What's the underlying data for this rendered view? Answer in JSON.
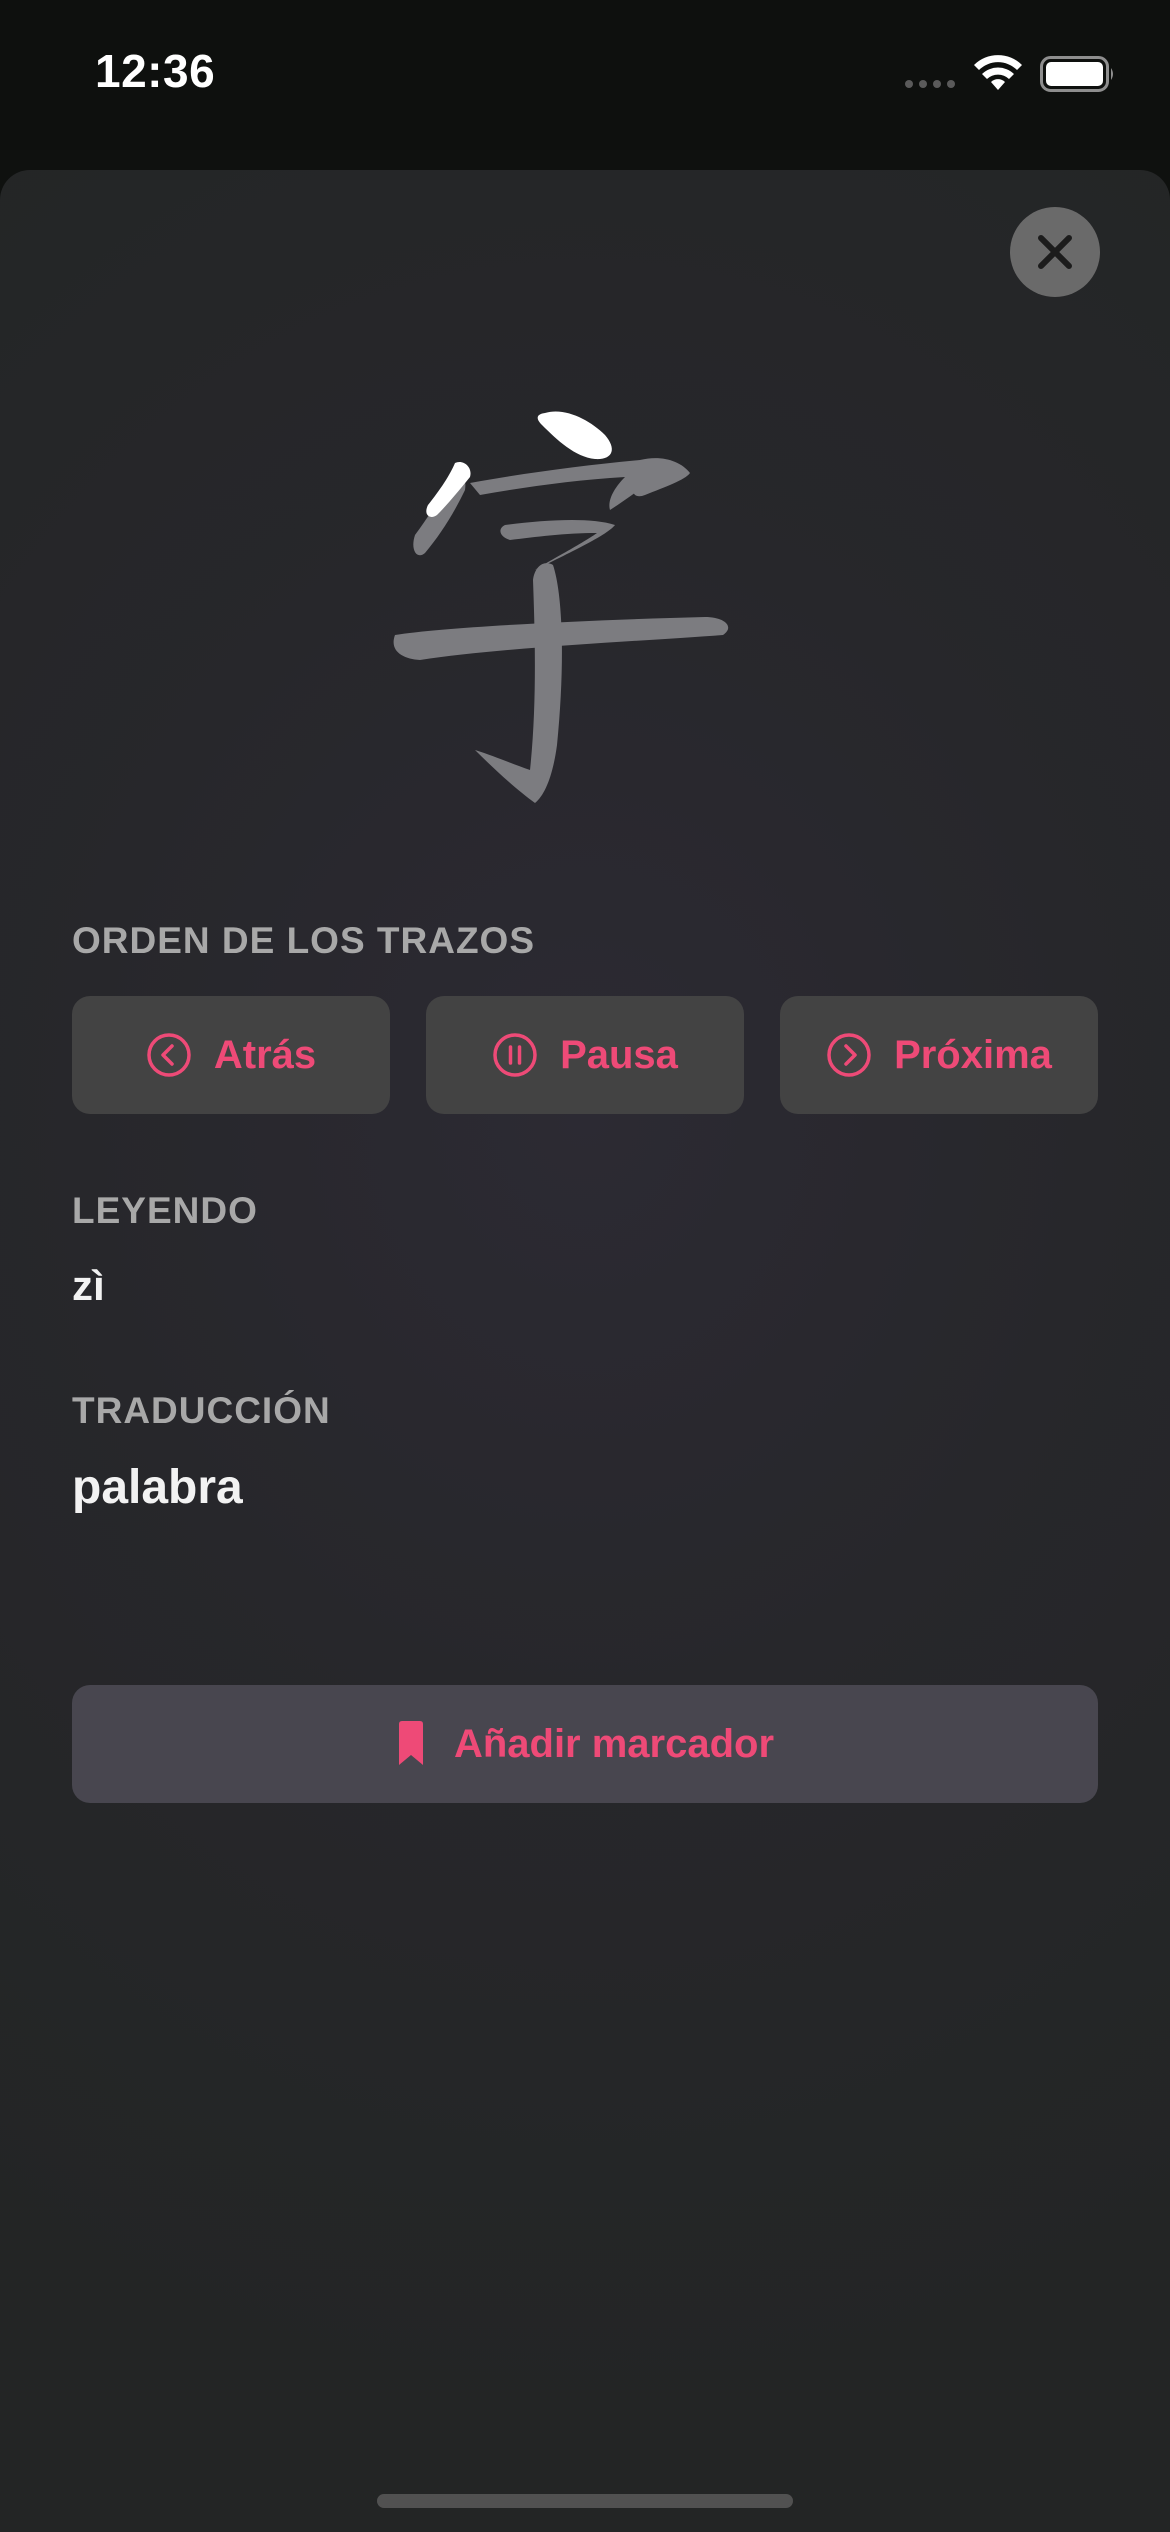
{
  "status_bar": {
    "time": "12:36",
    "icons": [
      "signal-icon",
      "wifi-icon",
      "battery-icon"
    ]
  },
  "character": {
    "glyph": "字",
    "stroke_colors": {
      "done": "#ffffff",
      "pending": "#7c7c80"
    }
  },
  "stroke_order": {
    "label": "ORDEN DE LOS TRAZOS",
    "back_label": "Atrás",
    "pause_label": "Pausa",
    "next_label": "Próxima"
  },
  "reading": {
    "label": "LEYENDO",
    "value": "zì"
  },
  "translation": {
    "label": "TRADUCCIÓN",
    "value": "palabra"
  },
  "bookmark": {
    "label": "Añadir marcador"
  },
  "colors": {
    "accent": "#ee4a77",
    "button_bg": "#434343",
    "sheet_bg": "#27272b"
  }
}
